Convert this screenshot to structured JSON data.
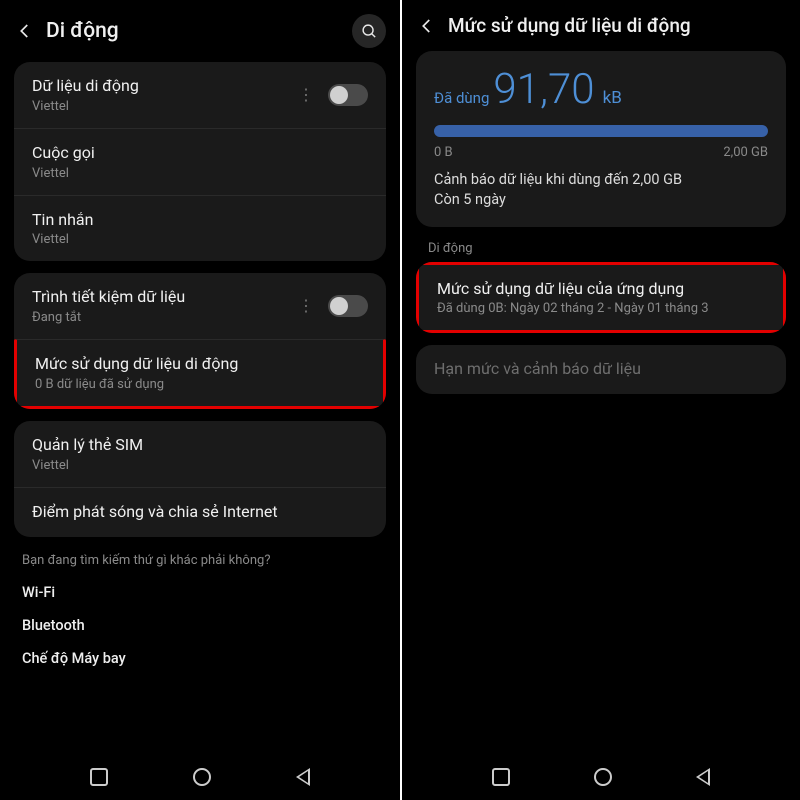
{
  "left": {
    "title": "Di động",
    "rows": {
      "mobile_data": {
        "title": "Dữ liệu di động",
        "sub": "Viettel"
      },
      "calls": {
        "title": "Cuộc gọi",
        "sub": "Viettel"
      },
      "sms": {
        "title": "Tin nhắn",
        "sub": "Viettel"
      },
      "saver": {
        "title": "Trình tiết kiệm dữ liệu",
        "sub": "Đang tắt"
      },
      "usage": {
        "title": "Mức sử dụng dữ liệu di động",
        "sub": "0 B dữ liệu đã sử dụng"
      },
      "sim": {
        "title": "Quản lý thẻ SIM",
        "sub": "Viettel"
      },
      "hotspot": {
        "title": "Điểm phát sóng và chia sẻ Internet"
      }
    },
    "footer": {
      "hint": "Bạn đang tìm kiếm thứ gì khác phải không?",
      "wifi": "Wi-Fi",
      "bt": "Bluetooth",
      "airplane": "Chế độ Máy bay"
    }
  },
  "right": {
    "title": "Mức sử dụng dữ liệu di động",
    "usage": {
      "label": "Đã dùng",
      "value": "91,70",
      "unit": "kB",
      "min": "0 B",
      "max": "2,00 GB",
      "warning": "Cảnh báo dữ liệu khi dùng đến 2,00 GB\nCòn 5 ngày"
    },
    "section": "Di động",
    "app_usage": {
      "title": "Mức sử dụng dữ liệu của ứng dụng",
      "sub": "Đã dùng 0B: Ngày 02 tháng 2 - Ngày 01 tháng 3"
    },
    "limit": {
      "title": "Hạn mức và cảnh báo dữ liệu"
    }
  }
}
